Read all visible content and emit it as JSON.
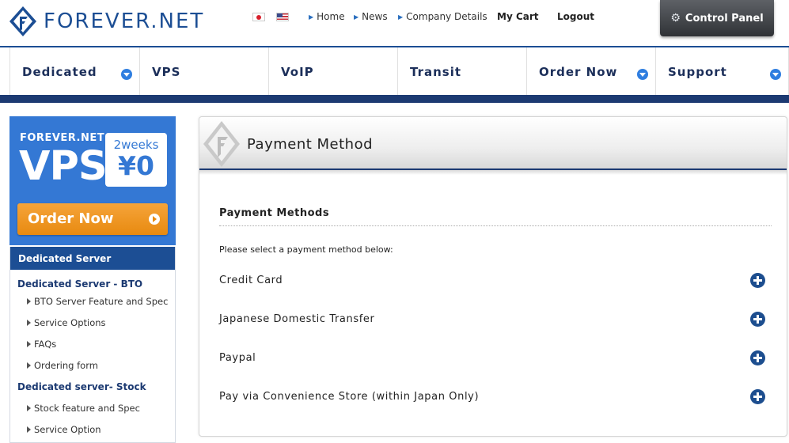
{
  "header": {
    "logo_text": "FOREVER.NET",
    "links": {
      "home": "Home",
      "news": "News",
      "company": "Company Details"
    },
    "cart": "My Cart",
    "logout": "Logout",
    "control_panel": "Control Panel"
  },
  "nav": {
    "items": [
      {
        "label": "Dedicated",
        "dropdown": true
      },
      {
        "label": "VPS",
        "dropdown": false
      },
      {
        "label": "VoIP",
        "dropdown": false
      },
      {
        "label": "Transit",
        "dropdown": false
      },
      {
        "label": "Order Now",
        "dropdown": true
      },
      {
        "label": "Support",
        "dropdown": true
      }
    ]
  },
  "promo": {
    "brand": "FOREVER.NET",
    "product": "VPS",
    "period": "2weeks",
    "price": "¥0",
    "order_button": "Order Now"
  },
  "sidebar": {
    "heading": "Dedicated Server",
    "group1": "Dedicated Server - BTO",
    "group1_links": [
      "BTO Server Feature and Spec",
      "Service Options",
      "FAQs",
      "Ordering form"
    ],
    "group2": "Dedicated server- Stock",
    "group2_links": [
      "Stock feature and Spec",
      "Service Option"
    ]
  },
  "content": {
    "page_title": "Payment Method",
    "section_title": "Payment Methods",
    "intro": "Please select a payment method below:",
    "methods": [
      "Credit Card",
      "Japanese Domestic Transfer",
      "Paypal",
      "Pay via Convenience Store (within Japan Only)"
    ]
  },
  "colors": {
    "brand_blue": "#1c4e94",
    "promo_blue": "#3478d4",
    "order_orange": "#f0961f"
  }
}
